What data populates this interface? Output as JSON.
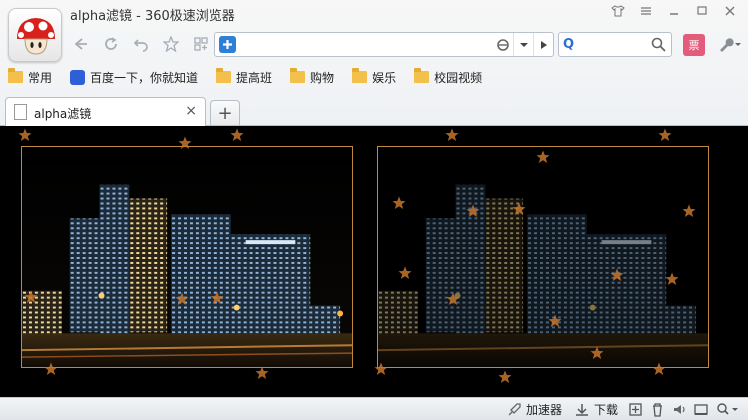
{
  "window": {
    "title": "alpha滤镜 - 360极速浏览器"
  },
  "toolbar": {
    "address_value": "",
    "search_value": "",
    "search_engine_glyph": "Q",
    "ticket_label": "票"
  },
  "bookmarks": [
    {
      "label": "常用",
      "icon": "folder-icon"
    },
    {
      "label": "百度一下，你就知道",
      "icon": "baidu-paw-icon"
    },
    {
      "label": "提高班",
      "icon": "folder-icon"
    },
    {
      "label": "购物",
      "icon": "folder-icon"
    },
    {
      "label": "娱乐",
      "icon": "folder-icon"
    },
    {
      "label": "校园视频",
      "icon": "folder-icon"
    }
  ],
  "tabs": [
    {
      "label": "alpha滤镜"
    }
  ],
  "statusbar": {
    "accelerator_label": "加速器",
    "download_label": "下载"
  },
  "colors": {
    "accent_blue": "#2d7fd8",
    "star_orange": "#c7762a",
    "photo_border": "#c08a3e"
  }
}
